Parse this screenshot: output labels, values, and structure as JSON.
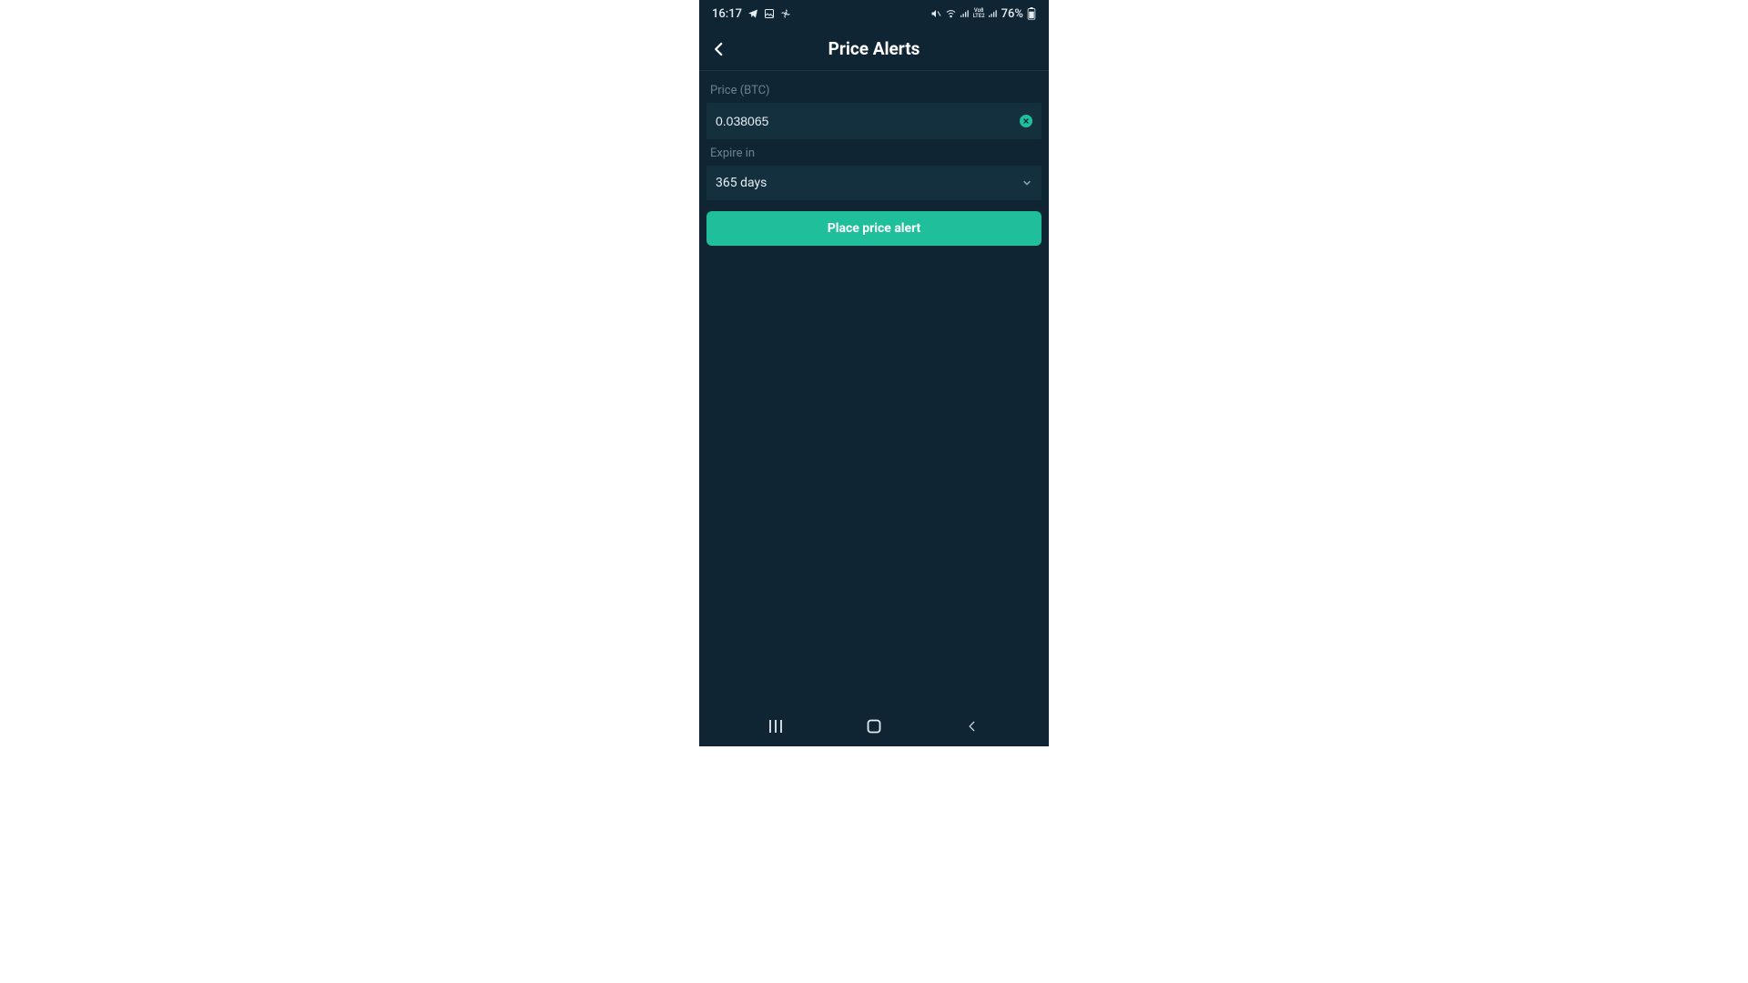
{
  "status": {
    "time": "16:17",
    "battery": "76%"
  },
  "header": {
    "title": "Price Alerts"
  },
  "form": {
    "price_label": "Price (BTC)",
    "price_value": "0.038065",
    "expire_label": "Expire in",
    "expire_value": "365 days"
  },
  "cta_label": "Place price alert",
  "colors": {
    "accent": "#1fbf9c",
    "bg": "#0f2534",
    "field": "#14303f"
  }
}
